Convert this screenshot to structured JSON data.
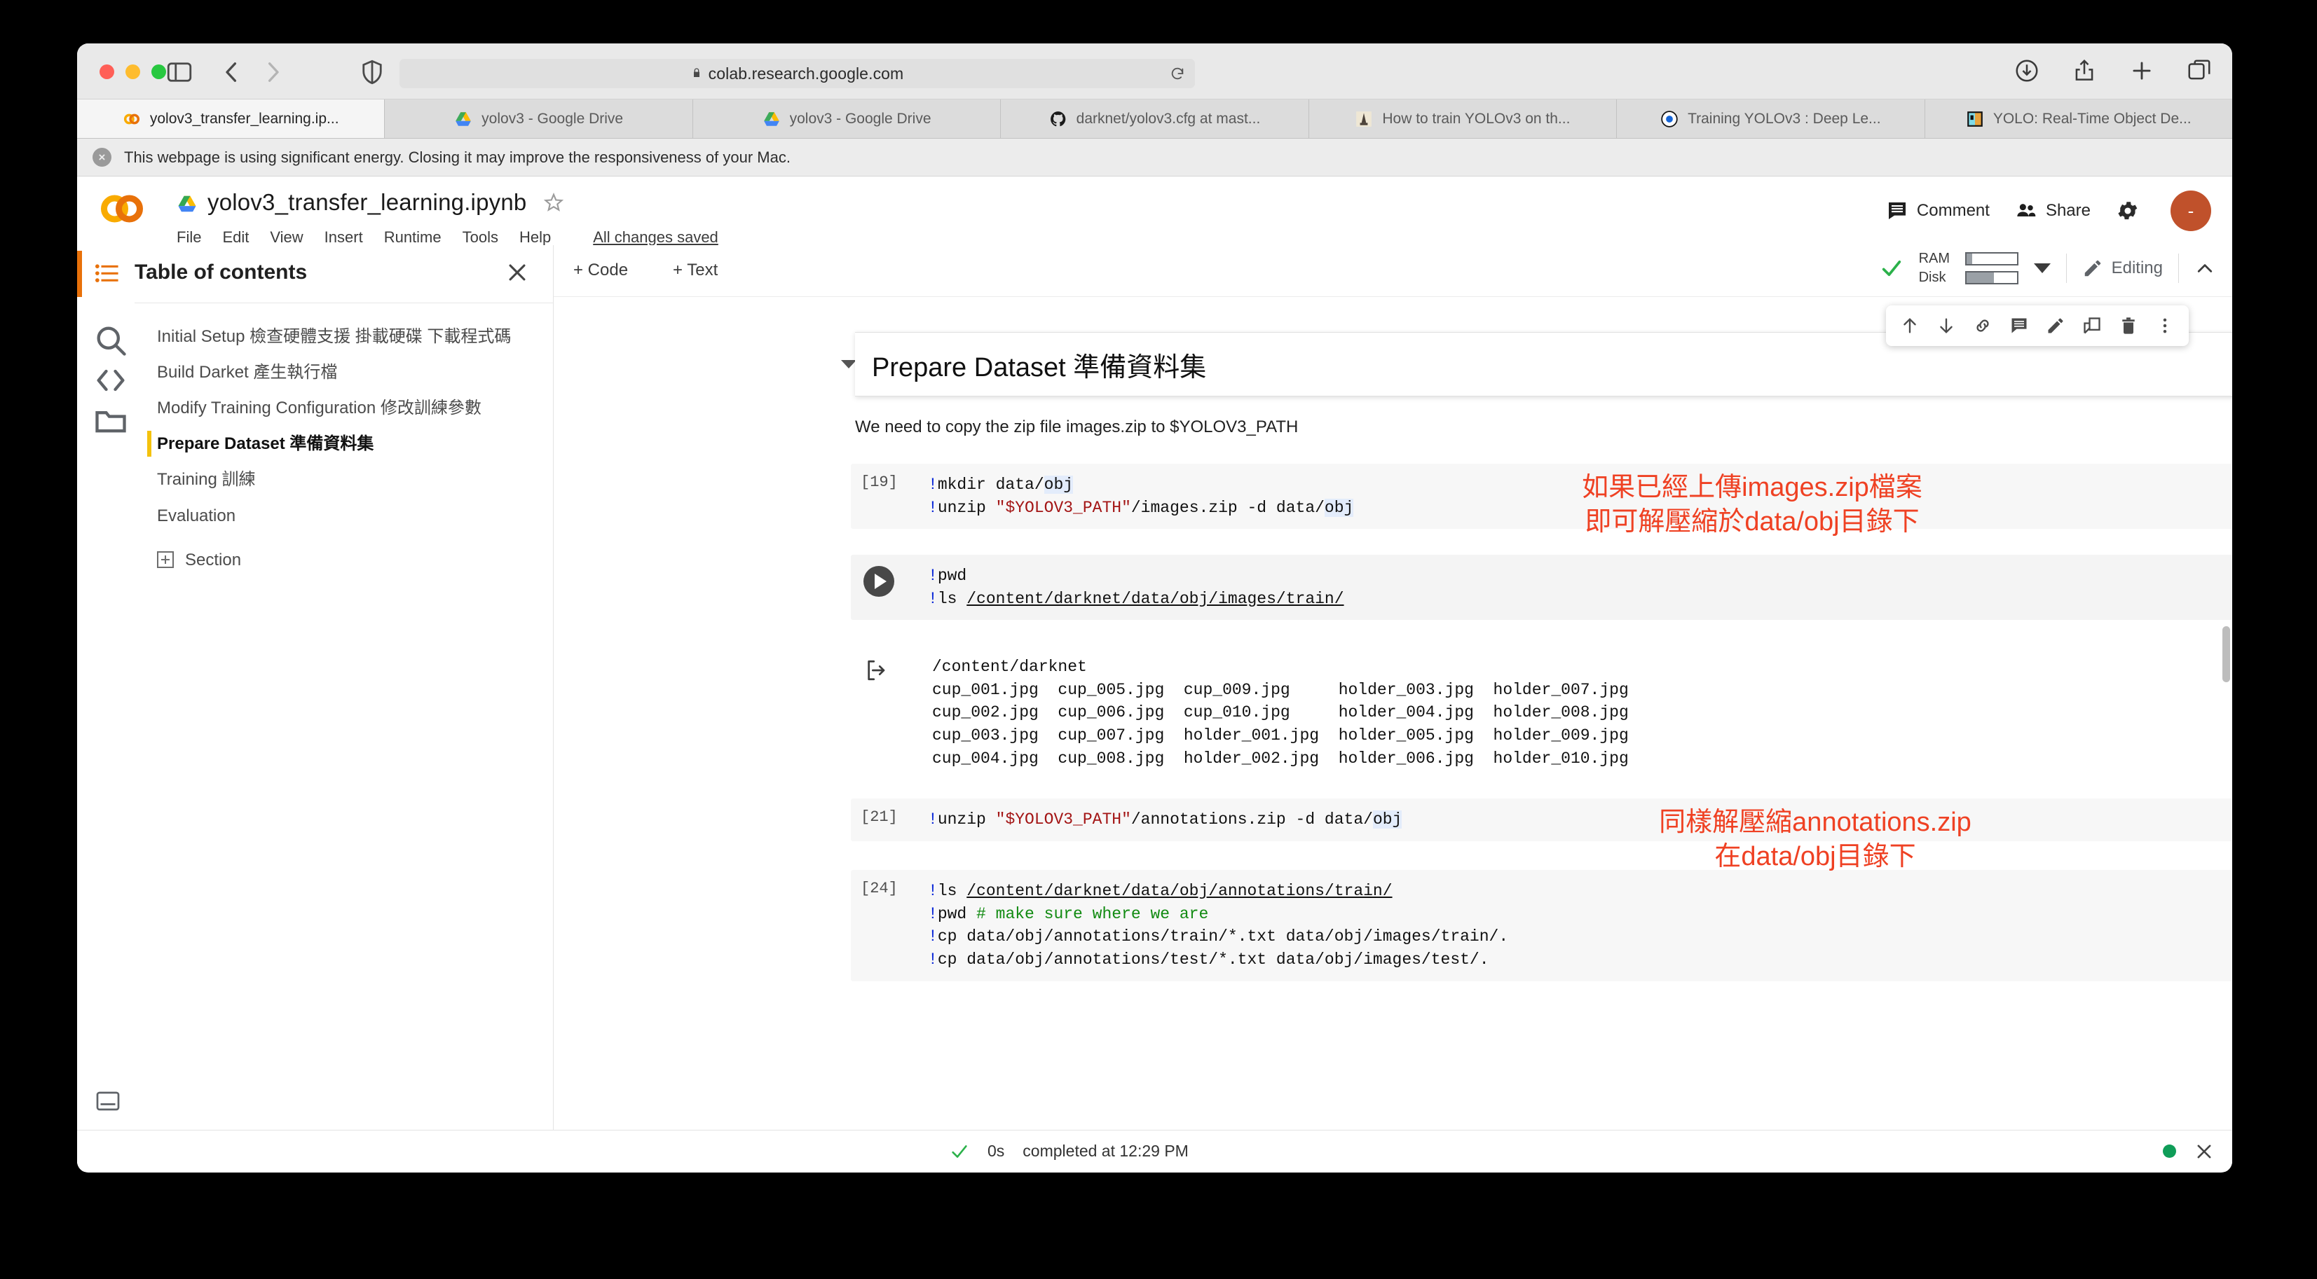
{
  "browser": {
    "url": "colab.research.google.com",
    "tabs": [
      {
        "label": "yolov3_transfer_learning.ip...",
        "icon": "colab-icon",
        "active": true
      },
      {
        "label": "yolov3 - Google Drive",
        "icon": "drive-icon",
        "active": false
      },
      {
        "label": "yolov3 - Google Drive",
        "icon": "drive-icon",
        "active": false
      },
      {
        "label": "darknet/yolov3.cfg at mast...",
        "icon": "github-icon",
        "active": false
      },
      {
        "label": "How to train YOLOv3 on th...",
        "icon": "article-icon",
        "active": false
      },
      {
        "label": "Training YOLOv3 : Deep Le...",
        "icon": "target-icon",
        "active": false
      },
      {
        "label": "YOLO: Real-Time Object De...",
        "icon": "yolo-icon",
        "active": false
      }
    ],
    "notice": "This webpage is using significant energy. Closing it may improve the responsiveness of your Mac.",
    "notice_close": "×"
  },
  "colab": {
    "notebook_title": "yolov3_transfer_learning.ipynb",
    "menus": [
      "File",
      "Edit",
      "View",
      "Insert",
      "Runtime",
      "Tools",
      "Help"
    ],
    "save_status": "All changes saved",
    "comment_label": "Comment",
    "share_label": "Share",
    "avatar_initial": "-"
  },
  "toc": {
    "title": "Table of contents",
    "items": [
      {
        "label": "Initial Setup 檢查硬體支援 掛載硬碟 下載程式碼",
        "active": false
      },
      {
        "label": "Build Darket 產生執行檔",
        "active": false
      },
      {
        "label": "Modify Training Configuration 修改訓練參數",
        "active": false
      },
      {
        "label": "Prepare Dataset 準備資料集",
        "active": true
      },
      {
        "label": "Training 訓練",
        "active": false
      },
      {
        "label": "Evaluation",
        "active": false
      }
    ],
    "section_label": "Section"
  },
  "toolbar": {
    "add_code": "+ Code",
    "add_text": "+ Text",
    "ram_label": "RAM",
    "disk_label": "Disk",
    "ram_fill_pct": 12,
    "disk_fill_pct": 55,
    "editing_label": "Editing"
  },
  "notebook": {
    "faded_top_line": "",
    "heading": "Prepare Dataset 準備資料集",
    "markdown_text": "We need to copy the zip file images.zip to $YOLOV3_PATH",
    "cells": [
      {
        "prompt": "[19]",
        "lines": [
          "!mkdir data/obj",
          "!unzip \"$YOLOV3_PATH\"/images.zip -d data/obj"
        ]
      },
      {
        "prompt": "run",
        "lines": [
          "!pwd",
          "!ls /content/darknet/data/obj/images/train/"
        ]
      },
      {
        "prompt": "output",
        "lines": [
          "/content/darknet",
          "cup_001.jpg  cup_005.jpg  cup_009.jpg    holder_003.jpg  holder_007.jpg",
          "cup_002.jpg  cup_006.jpg  cup_010.jpg    holder_004.jpg  holder_008.jpg",
          "cup_003.jpg  cup_007.jpg  holder_001.jpg  holder_005.jpg  holder_009.jpg",
          "cup_004.jpg  cup_008.jpg  holder_002.jpg  holder_006.jpg  holder_010.jpg"
        ]
      },
      {
        "prompt": "[21]",
        "lines": [
          "!unzip \"$YOLOV3_PATH\"/annotations.zip -d data/obj"
        ]
      },
      {
        "prompt": "[24]",
        "lines": [
          "!ls /content/darknet/data/obj/annotations/train/",
          "!pwd # make sure where we are",
          "!cp data/obj/annotations/train/*.txt data/obj/images/train/.",
          "!cp data/obj/annotations/test/*.txt data/obj/images/test/."
        ]
      }
    ],
    "annotations": [
      {
        "text": "如果已經上傳images.zip檔案\n即可解壓縮於data/obj目錄下",
        "color": "#ef4123"
      },
      {
        "text": "同樣解壓縮annotations.zip\n在data/obj目錄下",
        "color": "#ef4123"
      }
    ]
  },
  "footer": {
    "duration": "0s",
    "message": "completed at 12:29 PM"
  }
}
